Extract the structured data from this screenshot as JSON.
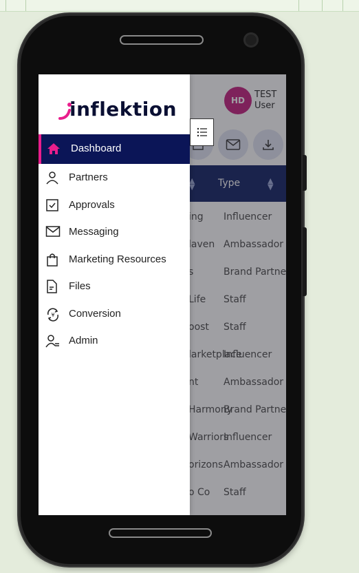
{
  "header": {
    "avatar_initials": "HD",
    "user_line1": "TEST",
    "user_line2": "User"
  },
  "table": {
    "columns": [
      "",
      "Type"
    ],
    "rows": [
      {
        "name": "ing",
        "type": "Influencer"
      },
      {
        "name": "laven",
        "type": "Ambassador"
      },
      {
        "name": "s",
        "type": "Brand Partne"
      },
      {
        "name": "Life",
        "type": "Staff"
      },
      {
        "name": "oost",
        "type": "Staff"
      },
      {
        "name": "larketplace",
        "type": "Influencer"
      },
      {
        "name": "nt",
        "type": "Ambassador"
      },
      {
        "name": "Harmony",
        "type": "Brand Partne"
      },
      {
        "name": "Warriors",
        "type": "Influencer"
      },
      {
        "name": "orizons",
        "type": "Ambassador"
      },
      {
        "name": "o Co",
        "type": "Staff"
      }
    ]
  },
  "drawer": {
    "logo_text": "inflektion",
    "items": [
      {
        "label": "Dashboard",
        "icon": "home-icon",
        "active": true
      },
      {
        "label": "Partners",
        "icon": "user-icon"
      },
      {
        "label": "Approvals",
        "icon": "checkbox-icon"
      },
      {
        "label": "Messaging",
        "icon": "mail-icon"
      },
      {
        "label": "Marketing Resources",
        "icon": "shopping-bag-icon"
      },
      {
        "label": "Files",
        "icon": "file-icon"
      },
      {
        "label": "Conversion",
        "icon": "currency-exchange-icon"
      },
      {
        "label": "Admin",
        "icon": "user-settings-icon"
      }
    ]
  },
  "colors": {
    "brand_navy": "#0b1557",
    "brand_pink": "#e91e8c",
    "avatar_bg": "#c2187b"
  }
}
